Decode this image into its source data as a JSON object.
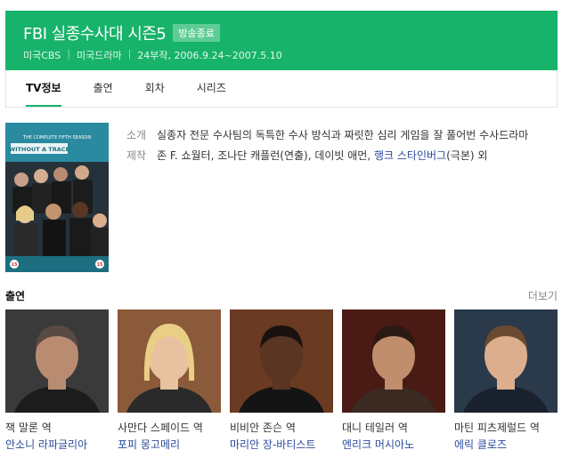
{
  "header": {
    "title": "FBI 실종수사대 시즌5",
    "badge": "방송종료",
    "meta": [
      "미국CBS",
      "미국드라마",
      "24부작, 2006.9.24~2007.5.10"
    ]
  },
  "tabs": [
    {
      "label": "TV정보",
      "active": true
    },
    {
      "label": "출연",
      "active": false
    },
    {
      "label": "회차",
      "active": false
    },
    {
      "label": "시리즈",
      "active": false
    }
  ],
  "poster": {
    "season_text": "THE COMPLETE FIFTH SEASON",
    "show_text": "WITHOUT A TRACE",
    "rating": "15"
  },
  "info": {
    "synopsis_label": "소개",
    "synopsis": "실종자 전문 수사팀의 독특한 수사 방식과 짜릿한 심리 게임을 잘 풀어번 수사드라마",
    "credits_label": "제작",
    "credits_prefix": "존 F. 쇼월터, 조나단 캐플런(연출), 데이빗 애먼, ",
    "credits_link": "행크 스타인버그",
    "credits_suffix": "(극본) 외"
  },
  "cast": {
    "title": "출연",
    "more": "더보기",
    "items": [
      {
        "role": "잭 말론 역",
        "name": "안소니 라파글리아",
        "skin": "#b98c72",
        "hair": "#5a4a44",
        "bg": "#3a3a3a",
        "shirt": "#1c1c1c"
      },
      {
        "role": "사만다 스페이드 역",
        "name": "포피 몽고메리",
        "skin": "#e8c2a0",
        "hair": "#e9cf86",
        "bg": "#8a5a3a",
        "shirt": "#2a2a2a"
      },
      {
        "role": "비비안 존슨 역",
        "name": "마리안 장-바티스트",
        "skin": "#5a3522",
        "hair": "#1a1210",
        "bg": "#6a3a22",
        "shirt": "#141414"
      },
      {
        "role": "대니 테일러 역",
        "name": "엔리크 머시아노",
        "skin": "#c08e6c",
        "hair": "#2a1a12",
        "bg": "#4a1a14",
        "shirt": "#3a2a22"
      },
      {
        "role": "마틴 피츠제럴드 역",
        "name": "에릭 클로즈",
        "skin": "#dcae8e",
        "hair": "#6a4a30",
        "bg": "#2a3a4a",
        "shirt": "#1a2230"
      }
    ]
  }
}
